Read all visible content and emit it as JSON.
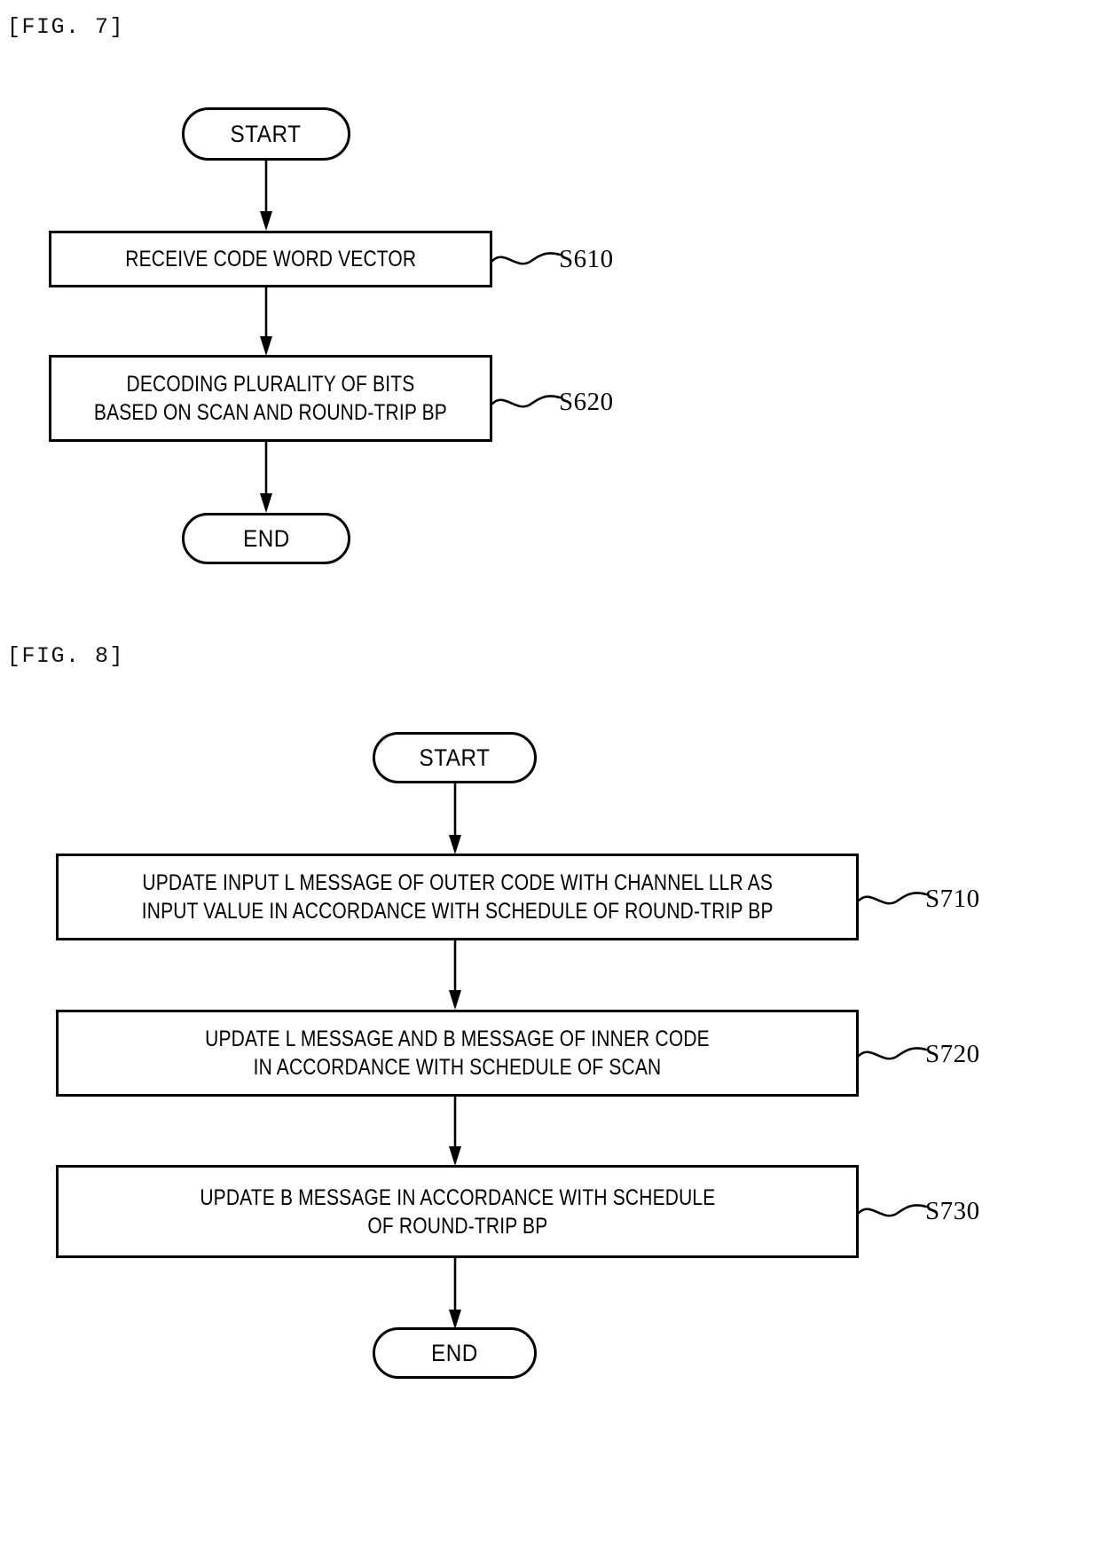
{
  "figures": [
    {
      "caption": "[FIG. 7]",
      "nodes": {
        "start": "START",
        "step1": "RECEIVE CODE WORD VECTOR",
        "step2": "DECODING PLURALITY OF BITS\nBASED ON SCAN AND ROUND-TRIP BP",
        "end": "END"
      },
      "refs": {
        "step1": "S610",
        "step2": "S620"
      }
    },
    {
      "caption": "[FIG. 8]",
      "nodes": {
        "start": "START",
        "step1": "UPDATE INPUT L MESSAGE OF OUTER CODE WITH CHANNEL LLR AS\nINPUT VALUE IN ACCORDANCE WITH SCHEDULE OF ROUND-TRIP BP",
        "step2": "UPDATE L MESSAGE AND B MESSAGE OF INNER CODE\nIN ACCORDANCE WITH SCHEDULE OF SCAN",
        "step3": "UPDATE B MESSAGE IN ACCORDANCE WITH SCHEDULE\nOF ROUND-TRIP BP",
        "end": "END"
      },
      "refs": {
        "step1": "S710",
        "step2": "S720",
        "step3": "S730"
      }
    }
  ],
  "colors": {
    "ink": "#000000",
    "paper": "#ffffff"
  }
}
